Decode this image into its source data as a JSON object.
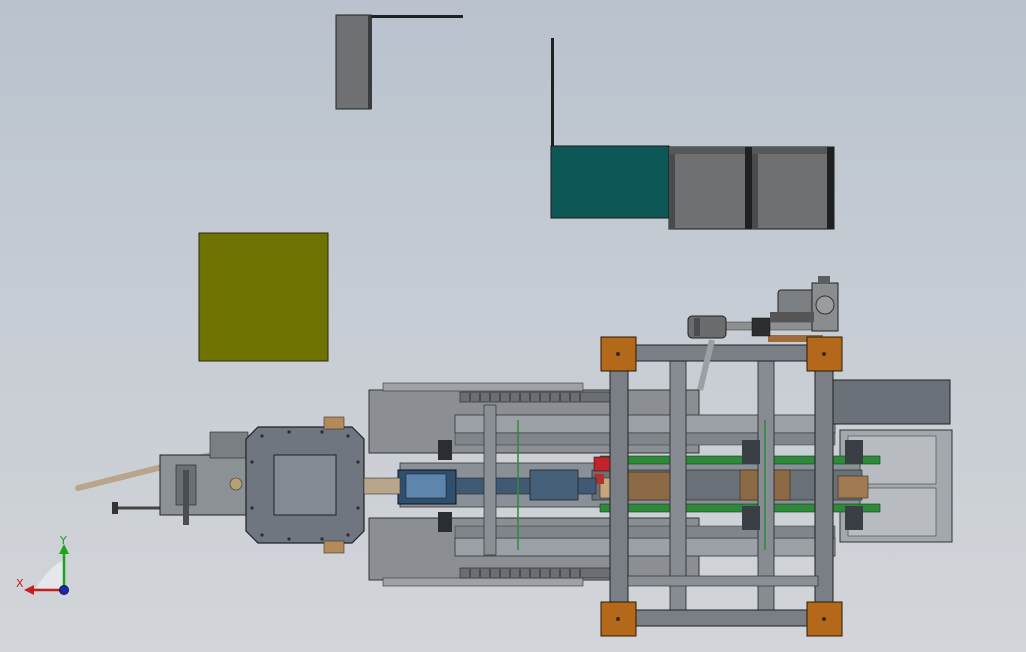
{
  "viewport": {
    "background_top": "#b9c2cd",
    "background_bottom": "#d2d5d9"
  },
  "triad": {
    "y_label": "Y",
    "x_label": "X",
    "y_color": "#1aa41a",
    "x_color": "#c81e1e",
    "z_color": "#1c2aa8"
  },
  "colors": {
    "cabinet_gray": "#6e7071",
    "cabinet_teal": "#0e5757",
    "plate_olive": "#6e7200",
    "frame_gray": "#7a7f86",
    "corner_orange": "#b3681a",
    "panel_dark": "#55606b",
    "screen_blue": "#3a6f9a",
    "belt_green": "#2e8a3a",
    "pipe_tan": "#b9a58c",
    "red_part": "#c0242a"
  }
}
